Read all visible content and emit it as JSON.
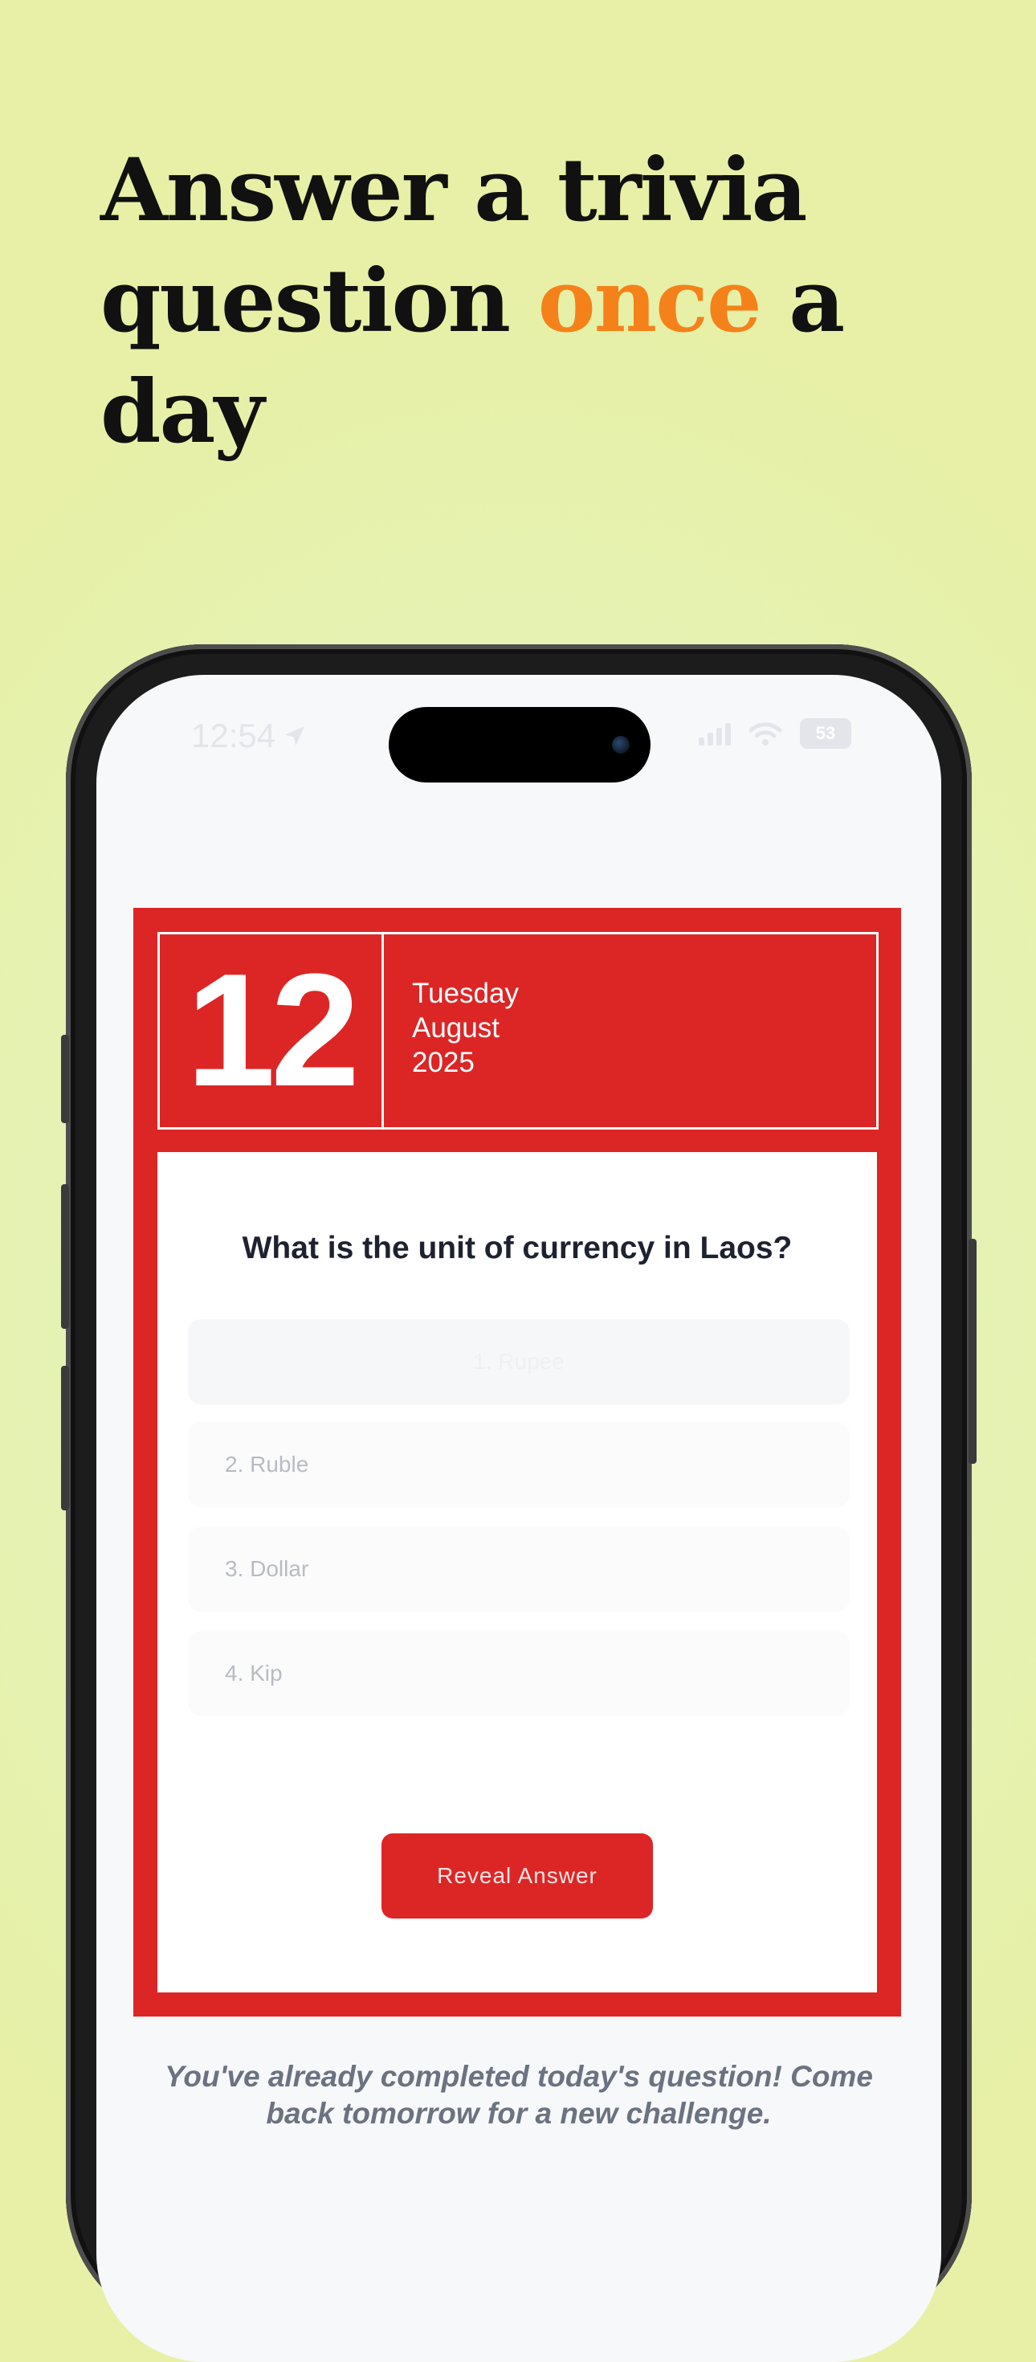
{
  "promo": {
    "headline_part1": "Answer a trivia question ",
    "headline_accent": "once",
    "headline_part2": " a day",
    "accent_color": "#f5811b"
  },
  "status_bar": {
    "time": "12:54",
    "battery": "53",
    "icons": [
      "location-arrow-icon",
      "signal-bars-icon",
      "wifi-icon",
      "battery-icon"
    ]
  },
  "calendar": {
    "day": "12",
    "weekday": "Tuesday",
    "month": "August",
    "year": "2025",
    "color": "#dc2626"
  },
  "trivia": {
    "question": "What is the unit of currency in Laos?",
    "options": [
      {
        "label": "1. Rupee"
      },
      {
        "label": "2. Ruble"
      },
      {
        "label": "3. Dollar"
      },
      {
        "label": "4. Kip"
      }
    ],
    "reveal_label": "Reveal Answer"
  },
  "completed_message": "You've already completed today's question! Come back tomorrow for a new challenge."
}
